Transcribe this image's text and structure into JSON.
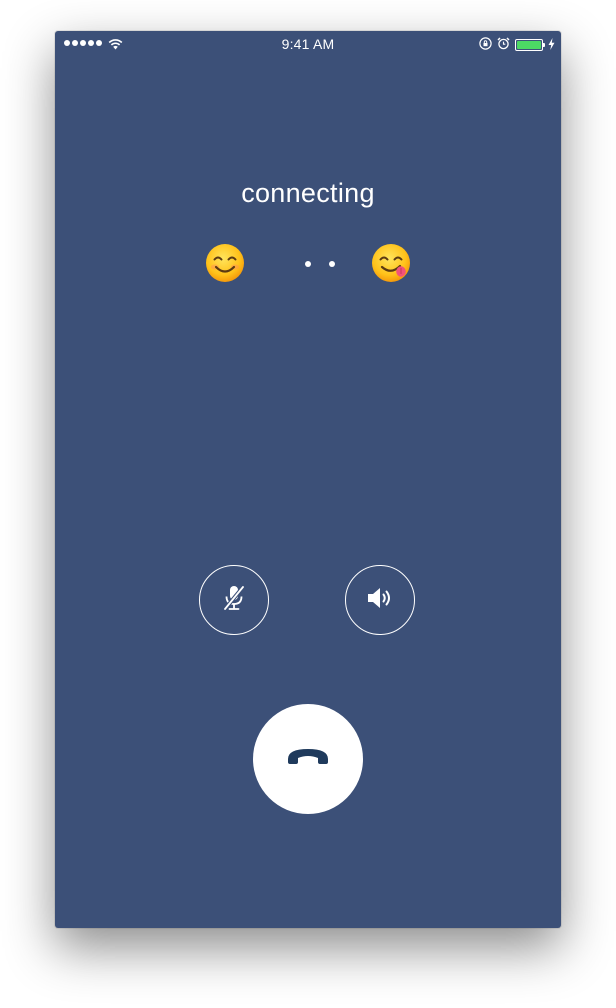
{
  "status_bar": {
    "time": "9:41 AM",
    "signal_dots": 5,
    "wifi_icon": "wifi-icon",
    "orientation_lock_icon": "orientation-lock-icon",
    "alarm_icon": "alarm-icon",
    "battery_level": 1.0,
    "battery_color": "#4cd964",
    "charging_icon": "charging-bolt-icon"
  },
  "call": {
    "status_text": "connecting",
    "caller_avatar": "smiling-face-emoji",
    "callee_avatar": "face-savoring-food-emoji"
  },
  "controls": {
    "mute_icon": "microphone-muted-icon",
    "speaker_icon": "speaker-icon",
    "end_call_icon": "hang-up-phone-icon"
  },
  "colors": {
    "background": "#3c5078",
    "end_call_icon": "#1f3a5c",
    "foreground": "#ffffff"
  }
}
